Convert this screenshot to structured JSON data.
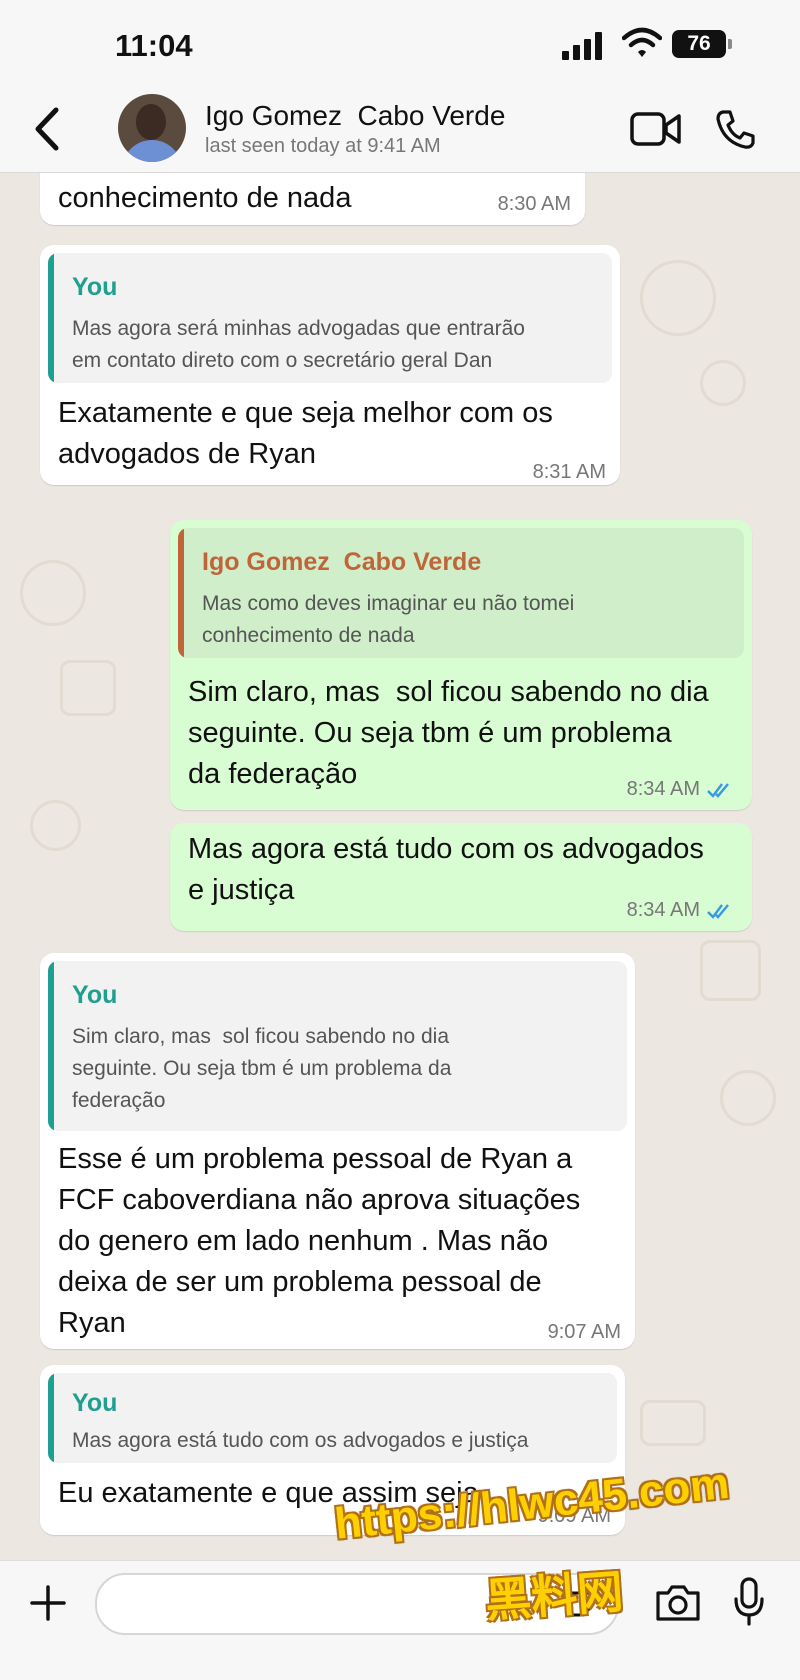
{
  "status_bar": {
    "time": "11:04",
    "battery": "76"
  },
  "header": {
    "contact_name": "Igo Gomez  Cabo Verde",
    "last_seen": "last seen today at 9:41 AM"
  },
  "messages": [
    {
      "direction": "in",
      "text": "Mas como deves imaginar eu não tomei\nconhecimento de nada",
      "time": "8:30 AM"
    },
    {
      "direction": "in",
      "quote_author": "You",
      "quote_text": "Mas agora será minhas advogadas que entrarão\nem contato direto com o secretário geral Dan",
      "text": "Exatamente e que seja melhor com os\nadvogados de Ryan",
      "time": "8:31 AM"
    },
    {
      "direction": "out",
      "quote_author": "Igo Gomez  Cabo Verde",
      "quote_text": "Mas como deves imaginar eu não tomei\nconhecimento de nada",
      "text": "Sim claro, mas  sol ficou sabendo no dia\nseguinte. Ou seja tbm é um problema\nda federação",
      "time": "8:34 AM"
    },
    {
      "direction": "out",
      "text": "Mas agora está tudo com os advogados\ne justiça",
      "time": "8:34 AM"
    },
    {
      "direction": "in",
      "quote_author": "You",
      "quote_text": "Sim claro, mas  sol ficou sabendo no dia\nseguinte. Ou seja tbm é um problema da\nfederação",
      "text": "Esse é um problema pessoal de Ryan a\nFCF caboverdiana não aprova situações\ndo genero em lado nenhum . Mas não\ndeixa de ser um problema pessoal de\nRyan",
      "time": "9:07 AM"
    },
    {
      "direction": "in",
      "quote_author": "You",
      "quote_text": "Mas agora está tudo com os advogados e justiça",
      "text": "Eu exatamente e que assim seja",
      "time": "9:09 AM"
    }
  ],
  "watermark": {
    "url": "https://hlwc45.com",
    "text": "黑料网"
  },
  "colors": {
    "quote_you": "#1f9f8f",
    "quote_contact": "#c0653a",
    "read_ticks": "#3b9be0",
    "outgoing_bg": "#d9fdd3"
  }
}
